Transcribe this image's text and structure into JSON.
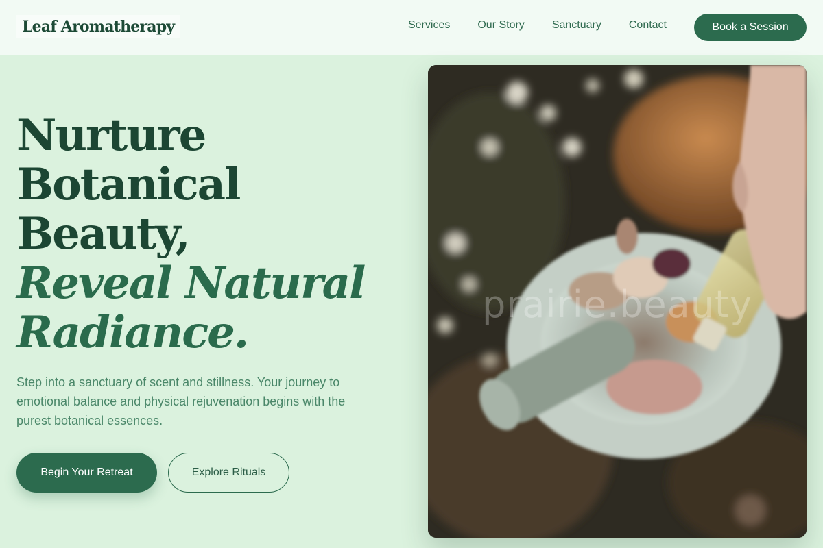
{
  "header": {
    "logo": "Leaf Aromatherapy",
    "nav": [
      "Services",
      "Our Story",
      "Sanctuary",
      "Contact"
    ],
    "cta": "Book a Session"
  },
  "hero": {
    "headline": {
      "line1": "Nurture",
      "line2": "Botanical",
      "line3": "Beauty,",
      "line4": "Reveal Natural",
      "line5": "Radiance."
    },
    "description": "Step into a sanctuary of scent and stillness. Your journey to emotional balance and physical rejuvenation begins with the purest botanical essences.",
    "primary_button": "Begin Your Retreat",
    "secondary_button": "Explore Rituals",
    "image": {
      "watermark": "prairie.beauty"
    }
  },
  "colors": {
    "background": "#dbf2de",
    "header_bg": "#f2faf4",
    "brand_green": "#2c6b4e",
    "heading": "#1c4633",
    "body_text": "#4a8769"
  }
}
